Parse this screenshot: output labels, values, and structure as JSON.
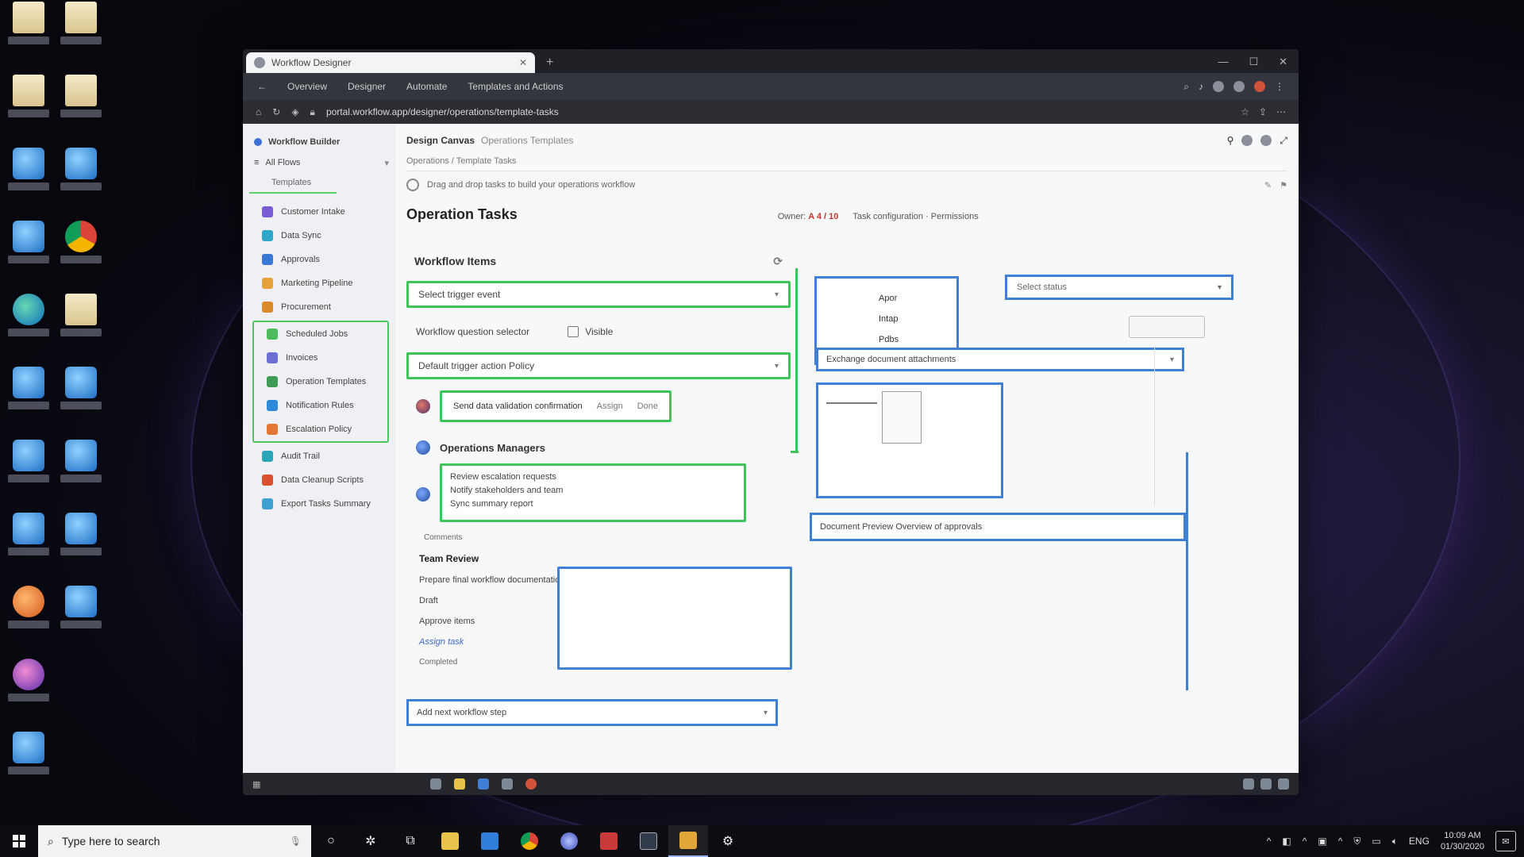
{
  "window": {
    "tab_title": "Workflow Designer",
    "menu": [
      "Overview",
      "Designer",
      "Automate",
      "Templates and Actions"
    ],
    "url": "portal.workflow.app/designer/operations/template-tasks"
  },
  "app": {
    "sidebar_title": "Workflow Builder",
    "sidebar_nav": "All Flows",
    "sidebar_group": "Templates",
    "sidebar_items": [
      {
        "label": "Customer Intake",
        "color": "#7a5bd6"
      },
      {
        "label": "Data Sync",
        "color": "#2ea6c8"
      },
      {
        "label": "Approvals",
        "color": "#3a78d6"
      },
      {
        "label": "Marketing Pipeline",
        "color": "#e5a23a"
      },
      {
        "label": "Procurement",
        "color": "#d98a2b"
      },
      {
        "label": "Scheduled Jobs",
        "color": "#4cbb5c"
      },
      {
        "label": "Invoices",
        "color": "#6a6fd1"
      },
      {
        "label": "Operation Templates",
        "color": "#3e9b55"
      },
      {
        "label": "Notification Rules",
        "color": "#2d88d8"
      },
      {
        "label": "Escalation Policy",
        "color": "#e27632"
      },
      {
        "label": "Audit Trail",
        "color": "#2aa5b8"
      },
      {
        "label": "Data Cleanup Scripts",
        "color": "#d9522d"
      },
      {
        "label": "Export Tasks Summary",
        "color": "#3f9fd0"
      }
    ],
    "page_title": "Design Canvas",
    "page_subtitle": "Operations Templates",
    "breadcrumb": "Operations / Template Tasks",
    "info_line": "Drag and drop tasks to build your operations workflow"
  },
  "section": {
    "title": "Operation Tasks",
    "meta_label": "Owner:",
    "meta_value": "A 4 / 10",
    "meta_extra": "Task configuration · Permissions"
  },
  "workflow": {
    "card_title": "Workflow Items",
    "dropdown_1": "Select trigger event",
    "field_label": "Workflow question selector",
    "checkbox_label": "Visible",
    "dropdown_2": "Default trigger action Policy",
    "task_row": "Send data validation confirmation",
    "task_row_extra": "Assign",
    "task_row_status": "Done",
    "group_title": "Operations Managers",
    "text_lines": [
      "Review escalation requests",
      "Notify stakeholders and team",
      "Sync summary report"
    ],
    "small_label": "Comments",
    "subtask_title": "Team Review",
    "subtask_desc": "Prepare final workflow documentation",
    "subtask_items": [
      "Draft",
      "Approve items",
      "Assign task"
    ],
    "subtask_tail": "Completed",
    "bottom_field": "Add next workflow step"
  },
  "canvas": {
    "list_items": [
      "Apor",
      "Intap",
      "Pdbs"
    ],
    "select_placeholder": "Select status",
    "long_field": "Exchange document attachments",
    "footer_field": "Document Preview Overview of approvals"
  },
  "taskbar": {
    "search_placeholder": "Type here to search",
    "lang": "ENG",
    "time": "10:09 AM",
    "date": "01/30/2020"
  }
}
